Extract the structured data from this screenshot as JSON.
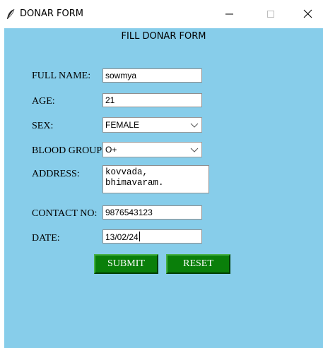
{
  "window": {
    "title": "DONAR FORM",
    "icon": "feather-icon",
    "controls": [
      "minimize-icon",
      "maximize-icon",
      "close-icon"
    ]
  },
  "form": {
    "heading": "FILL DONAR FORM",
    "full_name": {
      "label": "FULL NAME:",
      "value": "sowmya"
    },
    "age": {
      "label": "AGE:",
      "value": "21"
    },
    "sex": {
      "label": "SEX:",
      "value": "FEMALE"
    },
    "blood_group": {
      "label": "BLOOD GROUP",
      "value": "O+"
    },
    "address": {
      "label": "ADDRESS:",
      "value": "kovvada,\nbhimavaram."
    },
    "contact_no": {
      "label": "CONTACT NO:",
      "value": "9876543123"
    },
    "date": {
      "label": "DATE:",
      "value": "13/02/24"
    },
    "submit_label": "SUBMIT",
    "reset_label": "RESET"
  },
  "colors": {
    "background": "#87cdea",
    "button": "#0a7f0a",
    "button_text": "#ffffff"
  }
}
